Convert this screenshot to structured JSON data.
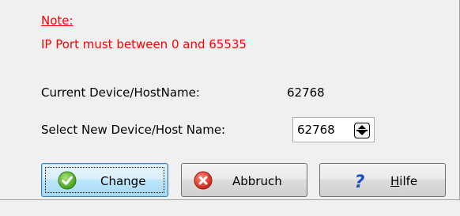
{
  "note": {
    "title": "Note:",
    "text": "IP Port must between 0 and 65535"
  },
  "current": {
    "label": "Current Device/HostName:",
    "value": "62768"
  },
  "new": {
    "label": "Select New Device/Host Name:",
    "value": "62768"
  },
  "buttons": {
    "change": "Change",
    "abbruch": "Abbruch",
    "hilfe_mnemonic": "H",
    "hilfe_rest": "ilfe"
  },
  "icons": {
    "change": "check-icon",
    "abbruch": "cancel-icon",
    "hilfe": "help-icon",
    "spinner": "spinner-updown-icon"
  },
  "colors": {
    "note": "#ff0000",
    "change_focus": "#3c7fb1",
    "check_green": "#5cb82e",
    "cancel_red": "#d8342c",
    "help_blue": "#1c4fc4"
  }
}
